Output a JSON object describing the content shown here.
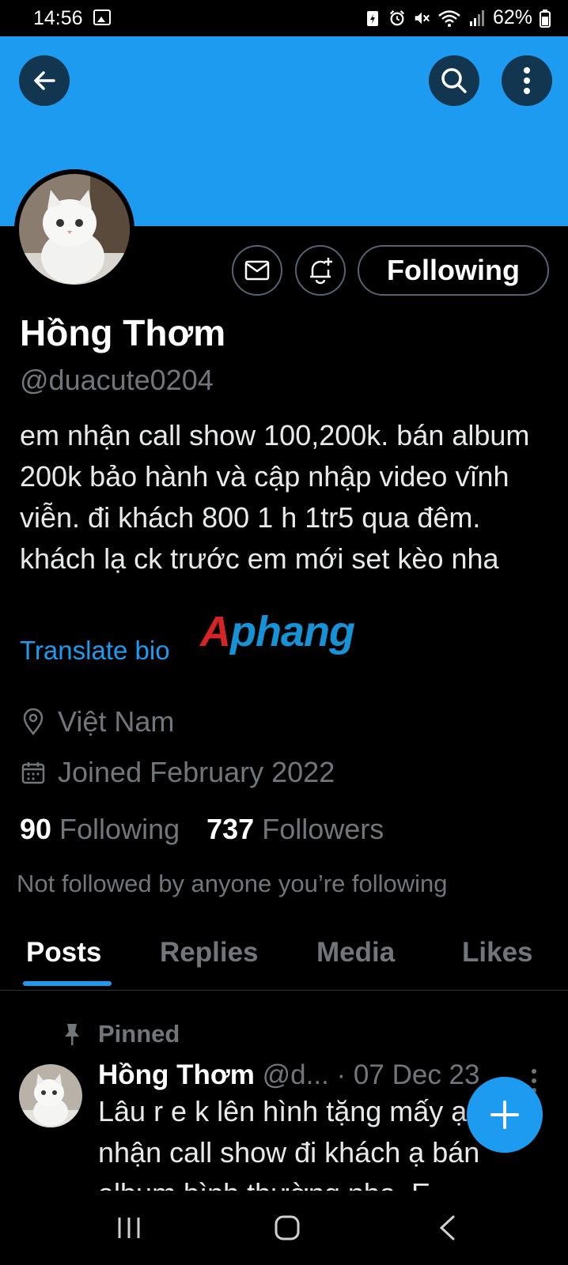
{
  "status_bar": {
    "time": "14:56",
    "battery": "62%",
    "icons": [
      "image-icon",
      "battery-saver-icon",
      "alarm-icon",
      "mute-icon",
      "wifi-icon",
      "signal-icon",
      "battery-icon"
    ]
  },
  "colors": {
    "banner": "#1d9bf0",
    "accent": "#1d9bf0",
    "background": "#000000",
    "secondary_text": "#71767b"
  },
  "header": {
    "back_icon": "arrow-left-icon",
    "search_icon": "search-icon",
    "more_icon": "more-vertical-icon"
  },
  "profile": {
    "display_name": "Hồng Thơm",
    "handle": "@duacute0204",
    "bio": "em nhận call show 100,200k. bán album 200k bảo hành và cập nhập video vĩnh viễn. đi khách 800 1 h 1tr5 qua đêm. khách lạ ck trước em mới set kèo nha",
    "translate_bio": "Translate bio",
    "location": "Việt Nam",
    "joined": "Joined February 2022",
    "following_count": "90",
    "following_label": "Following",
    "followers_count": "737",
    "followers_label": "Followers",
    "not_followed_text": "Not followed by anyone you’re following"
  },
  "actions": {
    "message_icon": "mail-icon",
    "notify_icon": "bell-plus-icon",
    "following_button": "Following"
  },
  "watermark": {
    "first_letter": "A",
    "rest": "phang"
  },
  "tabs": [
    {
      "label": "Posts",
      "active": true
    },
    {
      "label": "Replies",
      "active": false
    },
    {
      "label": "Media",
      "active": false
    },
    {
      "label": "Likes",
      "active": false
    }
  ],
  "post": {
    "pinned_label": "Pinned",
    "author_name": "Hồng Thơm",
    "author_handle": "@d...",
    "date": "· 07 Dec 23",
    "text": "Lâu r e k lên hình tặng mấy ạ vẫn nhận call show đi khách ạ bán album bình thường nha. E"
  },
  "fab": {
    "icon": "plus-icon"
  },
  "nav_bar": {
    "recent_icon": "recent-apps-icon",
    "home_icon": "home-icon",
    "back_icon": "nav-back-icon"
  }
}
